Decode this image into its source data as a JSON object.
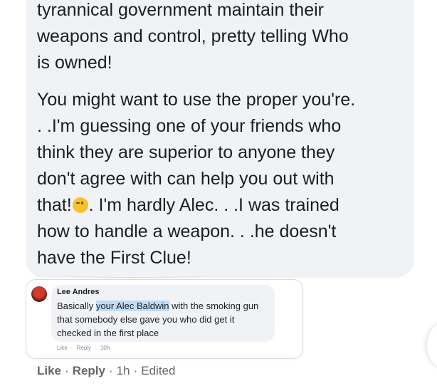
{
  "comment": {
    "para1_lines": [
      "tyrannical government maintain their",
      "weapons and control, pretty telling Who",
      "is owned!"
    ],
    "para2_line1": "You might want to use the proper you're.",
    "para2_line2": ". .I'm guessing one of your friends who",
    "para2_line3": "think they are superior to anyone they",
    "para2_line4": "don't agree with can help you out with",
    "para2_line5a": "that!",
    "emoji": "winking-face",
    "para2_line5b": ". I'm hardly Alec. . .I was trained",
    "para2_line6": "how to handle a weapon. . .he doesn't",
    "para2_line7": "have the First Clue!"
  },
  "screenshot": {
    "name": "Lee Andres",
    "text_before": "Basically ",
    "highlight": "your Alec Baldwin",
    "text_after": " with the smoking gun that somebody else gave you who did get it checked in the first place",
    "like": "Like",
    "reply": "Reply",
    "time": "10h"
  },
  "actions": {
    "like": "Like",
    "reply": "Reply",
    "time": "1h",
    "edited": "Edited",
    "separator": "·"
  },
  "colors": {
    "bubble": "#f0f2f5",
    "text": "#1c1e21",
    "meta": "#65676b",
    "highlight": "#bfdcf7"
  }
}
